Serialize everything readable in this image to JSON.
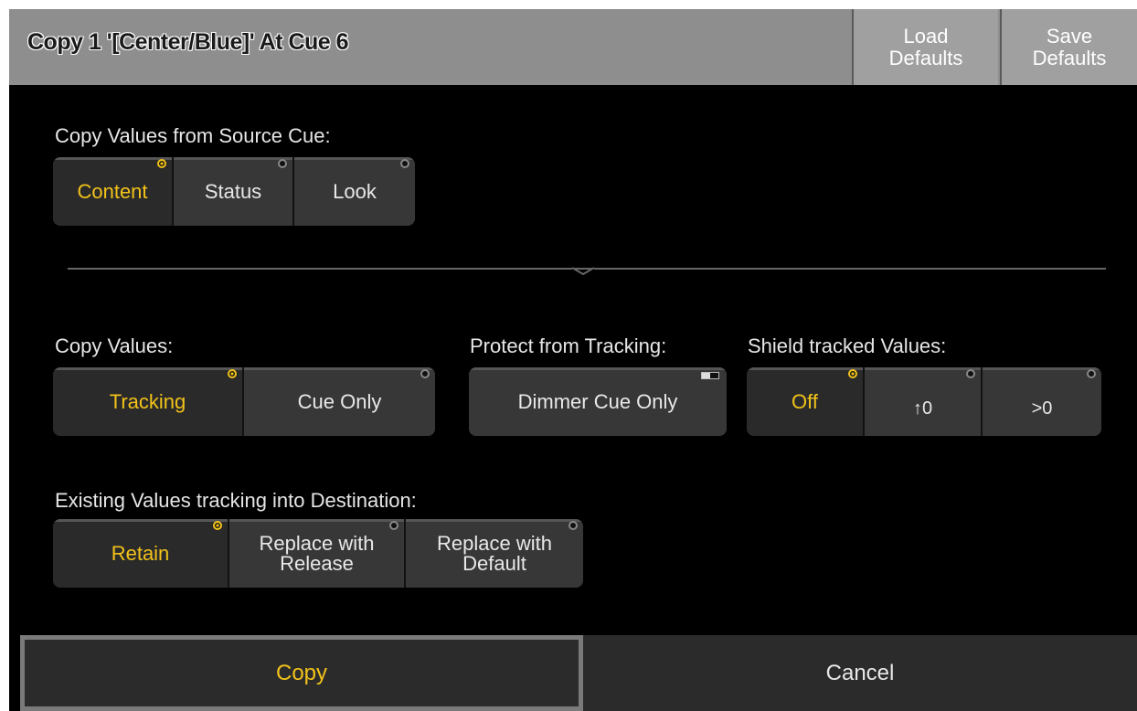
{
  "titlebar": {
    "title": "Copy  1 '[Center/Blue]' At  Cue 6",
    "load_defaults": [
      "Load",
      "Defaults"
    ],
    "save_defaults": [
      "Save",
      "Defaults"
    ]
  },
  "source_cue": {
    "label": "Copy Values from Source Cue:",
    "options": [
      "Content",
      "Status",
      "Look"
    ],
    "selected": "Content"
  },
  "copy_values": {
    "label": "Copy Values:",
    "options": [
      "Tracking",
      "Cue Only"
    ],
    "selected": "Tracking"
  },
  "protect": {
    "label": "Protect from Tracking:",
    "button": "Dimmer Cue Only"
  },
  "shield": {
    "label": "Shield tracked Values:",
    "options": [
      "Off",
      "↑0",
      ">0"
    ],
    "selected": "Off"
  },
  "existing": {
    "label": "Existing Values tracking into Destination:",
    "options": [
      "Retain",
      "Replace with\nRelease",
      "Replace with\nDefault"
    ],
    "selected": "Retain"
  },
  "footer": {
    "copy": "Copy",
    "cancel": "Cancel"
  },
  "colors": {
    "accent": "#f2c21a",
    "title_bar": "#8e8e8e",
    "background": "#000000"
  }
}
